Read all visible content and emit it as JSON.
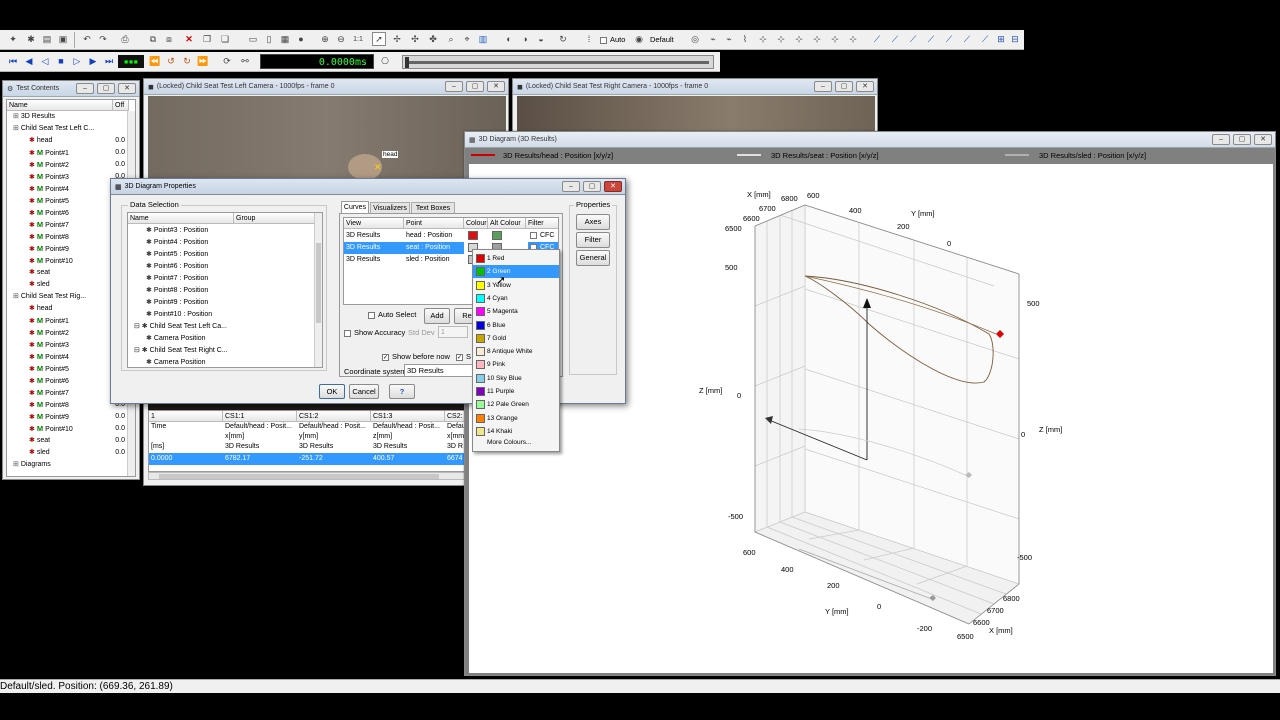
{
  "toolbar": {
    "auto_label": "Auto",
    "default_label": "Default",
    "time_display": "0.0000ms",
    "zoom_label": "1:1"
  },
  "test_contents": {
    "title": "Test Contents",
    "col_name": "Name",
    "col_off": "Off",
    "rows": [
      {
        "label": "3D Results",
        "val": ""
      },
      {
        "label": "Child Seat Test Left C...",
        "val": ""
      },
      {
        "label": "head",
        "val": "0.0"
      },
      {
        "label": "Point#1",
        "val": "0.0"
      },
      {
        "label": "Point#2",
        "val": "0.0"
      },
      {
        "label": "Point#3",
        "val": "0.0"
      },
      {
        "label": "Point#4",
        "val": "0.0"
      },
      {
        "label": "Point#5",
        "val": "0.0"
      },
      {
        "label": "Point#6",
        "val": "0.0"
      },
      {
        "label": "Point#7",
        "val": "0.0"
      },
      {
        "label": "Point#8",
        "val": "0.0"
      },
      {
        "label": "Point#9",
        "val": "0.0"
      },
      {
        "label": "Point#10",
        "val": "0.0"
      },
      {
        "label": "seat",
        "val": "0.0"
      },
      {
        "label": "sled",
        "val": "0.0"
      },
      {
        "label": "Child Seat Test Rig...",
        "val": ""
      },
      {
        "label": "head",
        "val": "0.0"
      },
      {
        "label": "Point#1",
        "val": "0.0"
      },
      {
        "label": "Point#2",
        "val": "0.0"
      },
      {
        "label": "Point#3",
        "val": "0.0"
      },
      {
        "label": "Point#4",
        "val": "0.0"
      },
      {
        "label": "Point#5",
        "val": "0.0"
      },
      {
        "label": "Point#6",
        "val": "0.0"
      },
      {
        "label": "Point#7",
        "val": "0.0"
      },
      {
        "label": "Point#8",
        "val": "0.0"
      },
      {
        "label": "Point#9",
        "val": "0.0"
      },
      {
        "label": "Point#10",
        "val": "0.0"
      },
      {
        "label": "seat",
        "val": "0.0"
      },
      {
        "label": "sled",
        "val": "0.0"
      },
      {
        "label": "Diagrams",
        "val": ""
      }
    ]
  },
  "left_camera": {
    "title": "(Locked) Child Seat Test Left Camera - 1000fps - frame 0",
    "marker": "head"
  },
  "right_camera": {
    "title": "(Locked) Child Seat Test Right Camera - 1000fps - frame 0"
  },
  "data_table": {
    "headers": [
      "1",
      "CS1:1",
      "CS1:2",
      "CS1:3",
      "CS2:"
    ],
    "row_time": [
      "Time",
      "Default/head : Posit...",
      "Default/head : Posit...",
      "Default/head : Posit...",
      "Defau"
    ],
    "row_unit": [
      "",
      "x[mm]",
      "y[mm]",
      "z[mm]",
      "x[mm]"
    ],
    "row_src": [
      "[ms]",
      "3D Results",
      "3D Results",
      "3D Results",
      "3D R"
    ],
    "row_val": [
      "0.0000",
      "6782.17",
      "-251.72",
      "400.57",
      "6674"
    ]
  },
  "diagram": {
    "title": "3D Diagram (3D Results)",
    "legend": [
      {
        "label": "3D Results/head : Position [x/y/z]",
        "color": "#cc0000"
      },
      {
        "label": "3D Results/seat : Position [x/y/z]",
        "color": "#e0e0e0"
      },
      {
        "label": "3D Results/sled : Position [x/y/z]",
        "color": "#b0b0b0"
      }
    ],
    "labels": {
      "x_top": "X [mm]",
      "y_top": "Y [mm]",
      "z_left": "Z [mm]",
      "z_right": "Z [mm]",
      "y_bottom": "Y [mm]",
      "x_bottom": "X [mm]"
    },
    "ticks": {
      "x_top": [
        "6800",
        "6700",
        "6600",
        "6500"
      ],
      "y_top": [
        "600",
        "400",
        "200",
        "0"
      ],
      "z_left": [
        "500",
        "0",
        "-500"
      ],
      "z_right": [
        "500",
        "0",
        "-500"
      ],
      "y_bottom": [
        "600",
        "400",
        "200",
        "0",
        "-200"
      ],
      "x_bottom": [
        "6800",
        "6700",
        "6600",
        "6500"
      ]
    }
  },
  "dialog": {
    "title": "3D Diagram Properties",
    "data_selection": "Data Selection",
    "col_name": "Name",
    "col_group": "Group",
    "tree": [
      "Point#3 : Position",
      "Point#4 : Position",
      "Point#5 : Position",
      "Point#6 : Position",
      "Point#7 : Position",
      "Point#8 : Position",
      "Point#9 : Position",
      "Point#10 : Position",
      "Child Seat Test Left Ca...",
      "Camera Position",
      "Child Seat Test Right C...",
      "Camera Position"
    ],
    "tabs": [
      "Curves",
      "Visualizers",
      "Text Boxes"
    ],
    "curve_headers": [
      "View",
      "Point",
      "Colour",
      "Alt Colour",
      "Filter"
    ],
    "curves": [
      {
        "view": "3D Results",
        "point": "head : Position",
        "color": "#dd1111",
        "alt": "#5aa05a",
        "filter": "CFC"
      },
      {
        "view": "3D Results",
        "point": "seat : Position",
        "color": "#d8d8d8",
        "alt": "#a0a0a0",
        "filter": "CFC"
      },
      {
        "view": "3D Results",
        "point": "sled : Position",
        "color": "#c8c8c8",
        "alt": "#999999",
        "filter": ""
      }
    ],
    "auto_select": "Auto Select",
    "add": "Add",
    "remove": "Re",
    "show_accuracy": "Show Accuracy",
    "std_dev": "Std Dev",
    "std_dev_value": "1",
    "show_before_now": "Show before now",
    "show_after": "S",
    "coord_label": "Coordinate system:",
    "coord_value": "3D Results",
    "properties": "Properties",
    "axes": "Axes",
    "filter": "Filter",
    "general": "General",
    "ok": "OK",
    "cancel": "Cancel",
    "help": "?"
  },
  "color_menu": {
    "items": [
      {
        "label": "1 Red",
        "color": "#e00000"
      },
      {
        "label": "2 Green",
        "color": "#00c000"
      },
      {
        "label": "3 Yellow",
        "color": "#ffff00"
      },
      {
        "label": "4 Cyan",
        "color": "#00ffff"
      },
      {
        "label": "5 Magenta",
        "color": "#ff00ff"
      },
      {
        "label": "6 Blue",
        "color": "#0000e0"
      },
      {
        "label": "7 Gold",
        "color": "#c8a800"
      },
      {
        "label": "8 Antique White",
        "color": "#faebd7"
      },
      {
        "label": "9 Pink",
        "color": "#ffb6c1"
      },
      {
        "label": "10 Sky Blue",
        "color": "#87ceeb"
      },
      {
        "label": "11 Purple",
        "color": "#8000c0"
      },
      {
        "label": "12 Pale Green",
        "color": "#98fb98"
      },
      {
        "label": "13 Orange",
        "color": "#ff8000"
      },
      {
        "label": "14 Khaki",
        "color": "#f0e68c"
      }
    ],
    "more": "More Colours..."
  },
  "status_bar": {
    "text": "Default/sled. Position: (669.36, 261.89)"
  }
}
